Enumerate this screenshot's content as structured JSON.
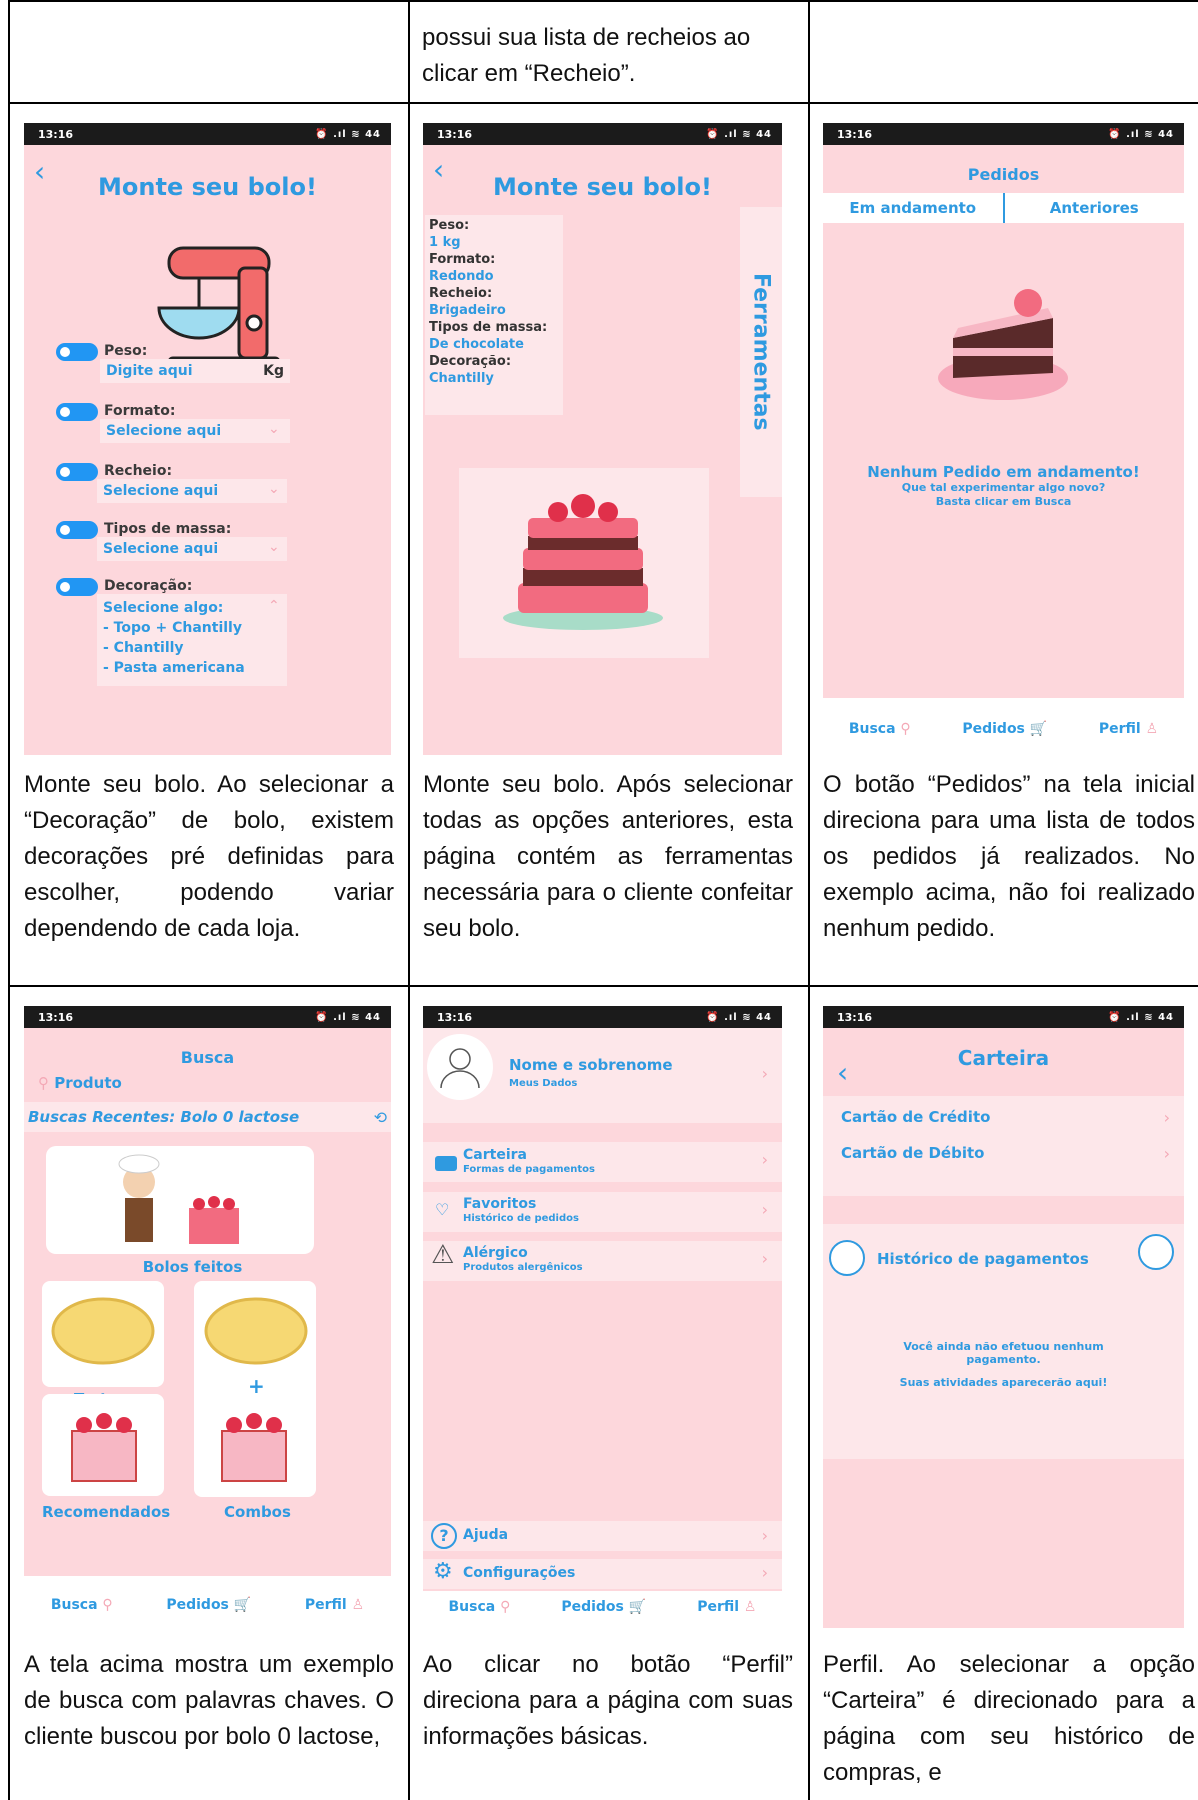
{
  "status_bar": {
    "time": "13:16",
    "icons": "⏰ .ıl ≋ 44"
  },
  "top_row": {
    "middle_text": "possui sua lista de recheios ao clicar em “Recheio”."
  },
  "screens": {
    "monte1": {
      "title": "Monte seu bolo!",
      "peso_label": "Peso:",
      "peso_placeholder": "Digite aqui",
      "peso_unit": "Kg",
      "formato_label": "Formato:",
      "formato_value": "Selecione aqui",
      "recheio_label": "Recheio:",
      "recheio_value": "Selecione aqui",
      "massa_label": "Tipos de massa:",
      "massa_value": "Selecione aqui",
      "decoracao_label": "Decoração:",
      "decoracao_value": "Selecione algo:",
      "decoracao_options": [
        "- Topo + Chantilly",
        "- Chantilly",
        "- Pasta americana"
      ]
    },
    "monte2": {
      "title": "Monte seu bolo!",
      "summary": [
        "Peso:",
        "1 kg",
        "Formato:",
        "Redondo",
        "Recheio:",
        "Brigadeiro",
        "Tipos de massa:",
        "De chocolate",
        "Decoração:",
        "Chantilly"
      ],
      "tools_label": "Ferramentas"
    },
    "pedidos": {
      "title": "Pedidos",
      "tab_current": "Em andamento",
      "tab_past": "Anteriores",
      "empty_title": "Nenhum Pedido em andamento!",
      "empty_line1": "Que tal experimentar algo novo?",
      "empty_line2": "Basta clicar em Busca"
    },
    "busca": {
      "title": "Busca",
      "search_placeholder": "Produto",
      "recent": "Buscas Recentes: Bolo 0 lactose",
      "cat_bolos": "Bolos feitos",
      "cat_tortas": "Tortas",
      "plus": "+",
      "cat_recomendados": "Recomendados",
      "cat_combos": "Combos"
    },
    "perfil": {
      "name": "Nome e sobrenome",
      "my_data": "Meus Dados",
      "carteira": "Carteira",
      "carteira_sub": "Formas de pagamentos",
      "favoritos": "Favoritos",
      "favoritos_sub": "Histórico de pedidos",
      "alergico": "Alérgico",
      "alergico_sub": "Produtos alergênicos",
      "ajuda": "Ajuda",
      "config": "Configurações"
    },
    "carteira": {
      "title": "Carteira",
      "credito": "Cartão de Crédito",
      "debito": "Cartão de Débito",
      "historico": "Histórico de pagamentos",
      "empty_line1": "Você ainda não efetuou nenhum pagamento.",
      "empty_line2": "Suas atividades aparecerão aqui!"
    }
  },
  "nav": {
    "busca": "Busca",
    "pedidos": "Pedidos",
    "perfil": "Perfil"
  },
  "captions": {
    "c1": "Monte seu bolo. Ao selecionar a “Decoração” de bolo, existem decorações pré definidas para escolher, podendo variar dependendo de cada loja.",
    "c2": "Monte seu bolo. Após selecionar todas as opções anteriores, esta página contém as ferramentas necessária para o cliente confeitar seu bolo.",
    "c3": "O botão “Pedidos” na tela inicial direciona para uma lista de todos os pedidos já realizados. No exemplo acima, não foi realizado nenhum pedido.",
    "c4": "A tela acima mostra um exemplo de busca com palavras chaves. O cliente buscou por bolo 0 lactose,",
    "c5": "Ao clicar no botão “Perfil” direciona para a página com suas informações básicas.",
    "c6": "Perfil. Ao selecionar a opção “Carteira” é direcionado para a página com seu histórico de compras, e"
  }
}
